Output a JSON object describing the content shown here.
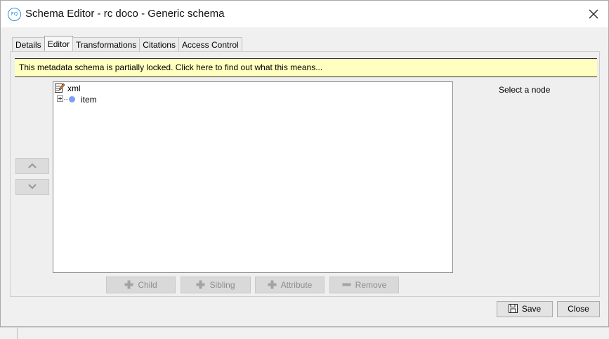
{
  "window": {
    "title": "Schema Editor - rc doco - Generic schema",
    "app_icon_text": "FQ"
  },
  "tabs": [
    {
      "label": "Details",
      "active": false
    },
    {
      "label": "Editor",
      "active": true
    },
    {
      "label": "Transformations",
      "active": false
    },
    {
      "label": "Citations",
      "active": false
    },
    {
      "label": "Access Control",
      "active": false
    }
  ],
  "notice": {
    "text": "This metadata schema is partially locked.  Click here to find out what this means..."
  },
  "tree": {
    "root": {
      "label": "xml",
      "icon": "edit-document-icon"
    },
    "children": [
      {
        "label": "item",
        "icon": "dot-node-icon",
        "expanded": false
      }
    ]
  },
  "side_panel": {
    "placeholder": "Select a node"
  },
  "actions": {
    "child": "Child",
    "sibling": "Sibling",
    "attribute": "Attribute",
    "remove": "Remove"
  },
  "footer": {
    "save": "Save",
    "close": "Close"
  },
  "colors": {
    "notice_bg": "#ffffc0",
    "node_dot": "#7f9ef2",
    "app_icon": "#2b8fd6"
  }
}
